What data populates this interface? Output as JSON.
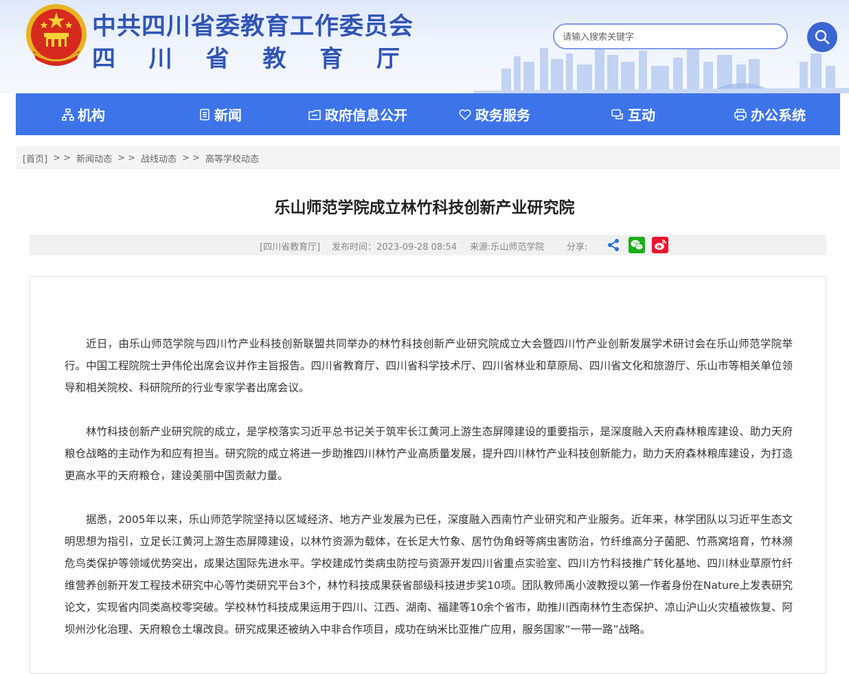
{
  "header": {
    "title_main": "中共四川省委教育工作委员会",
    "title_sub_chars": [
      "四",
      "川",
      "省",
      "教",
      "育",
      "厅"
    ],
    "search_placeholder": "请输入搜索关键字",
    "emblem": "national-emblem",
    "search_icon": "search-icon"
  },
  "nav": {
    "items": [
      {
        "label": "机构",
        "icon": "org-chart-icon"
      },
      {
        "label": "新闻",
        "icon": "document-icon"
      },
      {
        "label": "政府信息公开",
        "icon": "info-folder-icon"
      },
      {
        "label": "政务服务",
        "icon": "heart-hand-icon"
      },
      {
        "label": "互动",
        "icon": "chat-bubble-icon"
      },
      {
        "label": "办公系统",
        "icon": "printer-icon"
      }
    ]
  },
  "breadcrumb": {
    "items": [
      "[首页]",
      "新闻动态",
      "战线动态",
      "高等学校动态"
    ],
    "separator": "> >"
  },
  "article": {
    "title": "乐山师范学院成立林竹科技创新产业研究院",
    "source_tag": "[四川省教育厅]",
    "publish_time": "发布时间：2023-09-28 08:54",
    "source": "来源:乐山师范学院",
    "share_label": "分享:",
    "share_icons": [
      "share-icon",
      "wechat-icon",
      "weibo-icon"
    ],
    "paragraphs": [
      "近日，由乐山师范学院与四川竹产业科技创新联盟共同举办的林竹科技创新产业研究院成立大会暨四川竹产业创新发展学术研讨会在乐山师范学院举行。中国工程院院士尹伟伦出席会议并作主旨报告。四川省教育厅、四川省科学技术厅、四川省林业和草原局、四川省文化和旅游厅、乐山市等相关单位领导和相关院校、科研院所的行业专家学者出席会议。",
      "林竹科技创新产业研究院的成立，是学校落实习近平总书记关于筑牢长江黄河上游生态屏障建设的重要指示，是深度融入天府森林粮库建设、助力天府粮仓战略的主动作为和应有担当。研究院的成立将进一步助推四川林竹产业高质量发展，提升四川林竹产业科技创新能力，助力天府森林粮库建设，为打造更高水平的天府粮仓，建设美丽中国贡献力量。",
      "据悉，2005年以来，乐山师范学院坚持以区域经济、地方产业发展为已任，深度融入西南竹产业研究和产业服务。近年来，林学团队以习近平生态文明思想为指引，立足长江黄河上游生态屏障建设，以林竹资源为载体，在长足大竹象、居竹伪角蚜等病虫害防治，竹纤维高分子菌肥、竹燕窝培育，竹林濒危鸟类保护等领域优势突出，成果达国际先进水平。学校建成竹类病虫防控与资源开发四川省重点实验室、四川方竹科技推广转化基地、四川林业草原竹纤维营养创新开发工程技术研究中心等竹类研究平台3个，林竹科技成果获省部级科技进步奖10项。团队教师禹小波教授以第一作者身份在Nature上发表研究论文，实现省内同类高校零突破。学校林竹科技成果运用于四川、江西、湖南、福建等10余个省市，助推川西南林竹生态保护、凉山沪山火灾植被恢复、阿坝州沙化治理、天府粮仓土壤改良。研究成果还被纳入中非合作项目，成功在纳米比亚推广应用，服务国家“一带一路”战略。"
    ]
  },
  "colors": {
    "brand_blue": "#3d74e9",
    "title_blue": "#2f55b5",
    "wechat_green": "#1aad19",
    "weibo_red": "#e6162d"
  }
}
